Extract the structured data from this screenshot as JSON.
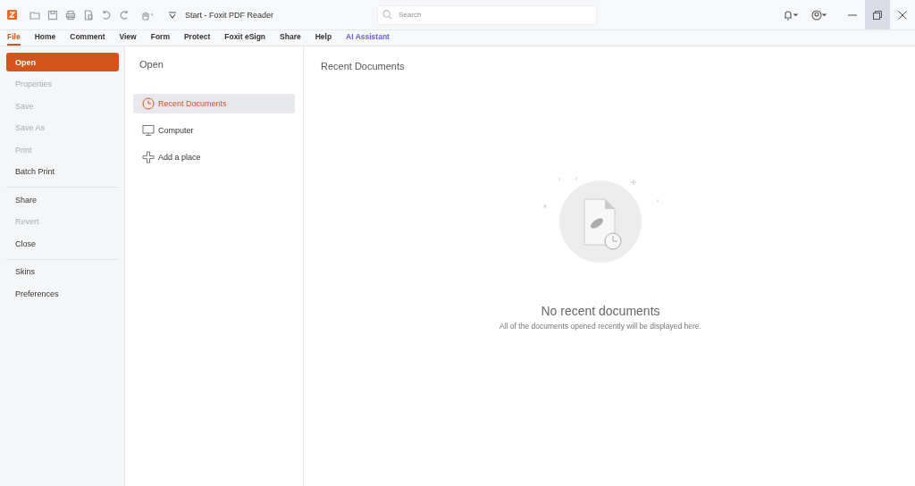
{
  "window": {
    "title": "Start - Foxit PDF Reader"
  },
  "search": {
    "placeholder": "Search"
  },
  "ribbon_tabs": [
    {
      "label": "File",
      "selected": true,
      "kind": "plain"
    },
    {
      "label": "Home",
      "selected": false,
      "kind": "plain"
    },
    {
      "label": "Comment",
      "selected": false,
      "kind": "plain"
    },
    {
      "label": "View",
      "selected": false,
      "kind": "plain"
    },
    {
      "label": "Form",
      "selected": false,
      "kind": "plain"
    },
    {
      "label": "Protect",
      "selected": false,
      "kind": "plain"
    },
    {
      "label": "Foxit eSign",
      "selected": false,
      "kind": "plain"
    },
    {
      "label": "Share",
      "selected": false,
      "kind": "plain"
    },
    {
      "label": "Help",
      "selected": false,
      "kind": "plain"
    },
    {
      "label": "AI Assistant",
      "selected": false,
      "kind": "ai"
    }
  ],
  "file_menu": [
    [
      {
        "label": "Open",
        "selected": true,
        "disabled": false
      },
      {
        "label": "Properties",
        "selected": false,
        "disabled": true
      },
      {
        "label": "Save",
        "selected": false,
        "disabled": true
      },
      {
        "label": "Save As",
        "selected": false,
        "disabled": true
      },
      {
        "label": "Print",
        "selected": false,
        "disabled": true
      },
      {
        "label": "Batch Print",
        "selected": false,
        "disabled": false
      }
    ],
    [
      {
        "label": "Share",
        "selected": false,
        "disabled": false
      },
      {
        "label": "Revert",
        "selected": false,
        "disabled": true
      },
      {
        "label": "Close",
        "selected": false,
        "disabled": false
      }
    ],
    [
      {
        "label": "Skins",
        "selected": false,
        "disabled": false
      },
      {
        "label": "Preferences",
        "selected": false,
        "disabled": false
      }
    ]
  ],
  "open_panel": {
    "title": "Open",
    "places": [
      {
        "label": "Recent Documents",
        "selected": true,
        "kind": "clock"
      },
      {
        "label": "Computer",
        "selected": false,
        "kind": "monitor"
      },
      {
        "label": "Add a place",
        "selected": false,
        "kind": "plus"
      }
    ]
  },
  "recent": {
    "title": "Recent Documents",
    "empty_title": "No recent documents",
    "empty_text": "All of the documents opened recently will be displayed here."
  }
}
